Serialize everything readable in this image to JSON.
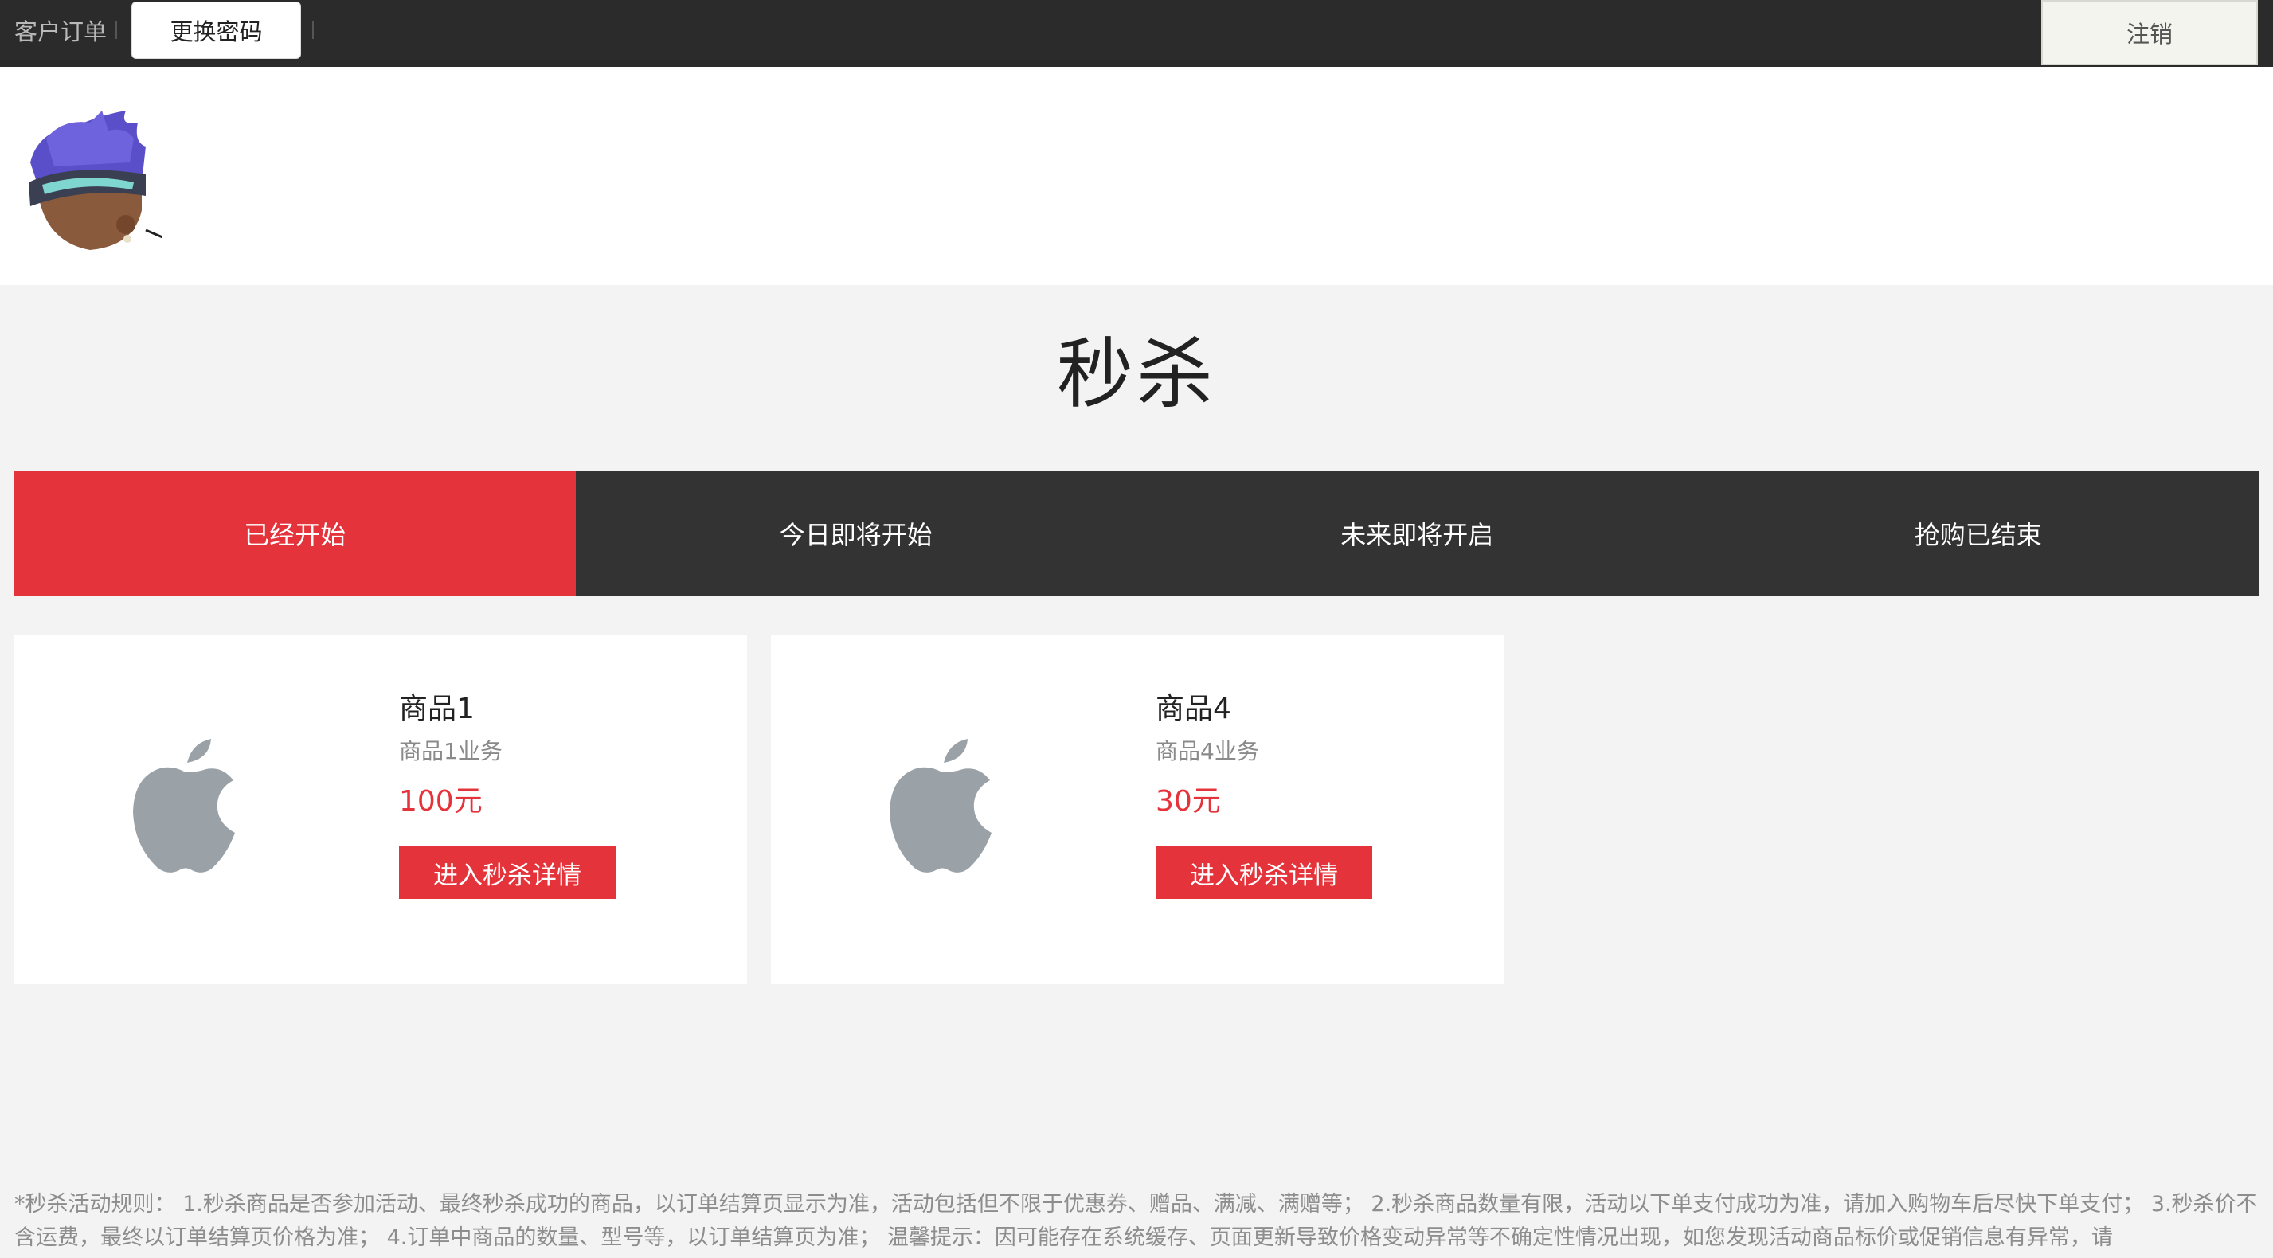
{
  "topbar": {
    "orders_label": "客户订单",
    "change_password_label": "更换密码",
    "logout_label": "注销"
  },
  "page": {
    "title": "秒杀"
  },
  "tabs": [
    {
      "label": "已经开始",
      "active": true
    },
    {
      "label": "今日即将开始",
      "active": false
    },
    {
      "label": "未来即将开启",
      "active": false
    },
    {
      "label": "抢购已结束",
      "active": false
    }
  ],
  "products": [
    {
      "name": "商品1",
      "desc": "商品1业务",
      "price": "100元",
      "button_label": "进入秒杀详情",
      "icon": "apple-logo-icon"
    },
    {
      "name": "商品4",
      "desc": "商品4业务",
      "price": "30元",
      "button_label": "进入秒杀详情",
      "icon": "apple-logo-icon"
    }
  ],
  "rules": {
    "text": "*秒杀活动规则：  1.秒杀商品是否参加活动、最终秒杀成功的商品，以订单结算页显示为准，活动包括但不限于优惠券、赠品、满减、满赠等；  2.秒杀商品数量有限，活动以下单支付成功为准，请加入购物车后尽快下单支付；  3.秒杀价不含运费，最终以订单结算页价格为准；  4.订单中商品的数量、型号等，以订单结算页为准；  温馨提示：因可能存在系统缓存、页面更新导致价格变动异常等不确定性情况出现，如您发现活动商品标价或促销信息有异常，请"
  },
  "colors": {
    "accent_red": "#e4333a",
    "topbar_bg": "#2b2b2b",
    "tabs_bg": "#333333",
    "page_bg": "#f3f3f3"
  }
}
